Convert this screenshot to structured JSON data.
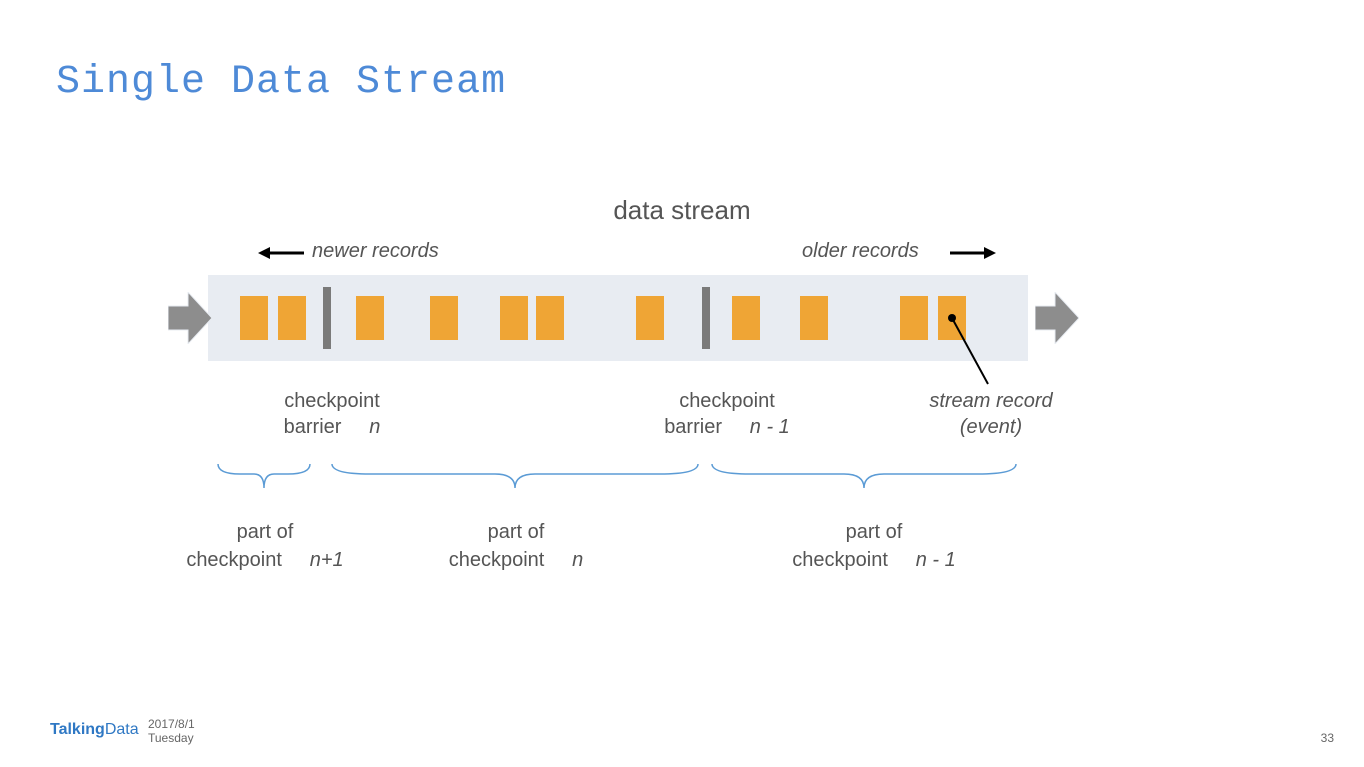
{
  "title": "Single Data Stream",
  "diagram": {
    "topLabel": "data stream",
    "newerRecords": "newer records",
    "olderRecords": "older records",
    "checkpointBarrier1_line1": "checkpoint",
    "checkpointBarrier1_line2_a": "barrier",
    "checkpointBarrier1_line2_b": "n",
    "checkpointBarrier2_line1": "checkpoint",
    "checkpointBarrier2_line2_a": "barrier",
    "checkpointBarrier2_line2_b": "n - 1",
    "streamRecord_line1": "stream record",
    "streamRecord_line2": "(event)",
    "part1_line1": "part of",
    "part1_line2_a": "checkpoint",
    "part1_line2_b": "n+1",
    "part2_line1": "part of",
    "part2_line2_a": "checkpoint",
    "part2_line2_b": "n",
    "part3_line1": "part of",
    "part3_line2_a": "checkpoint",
    "part3_line2_b": "n - 1"
  },
  "footer": {
    "logo_a": "Talking",
    "logo_b": "Data",
    "date": "2017/8/1",
    "day": "Tuesday",
    "page": "33"
  }
}
